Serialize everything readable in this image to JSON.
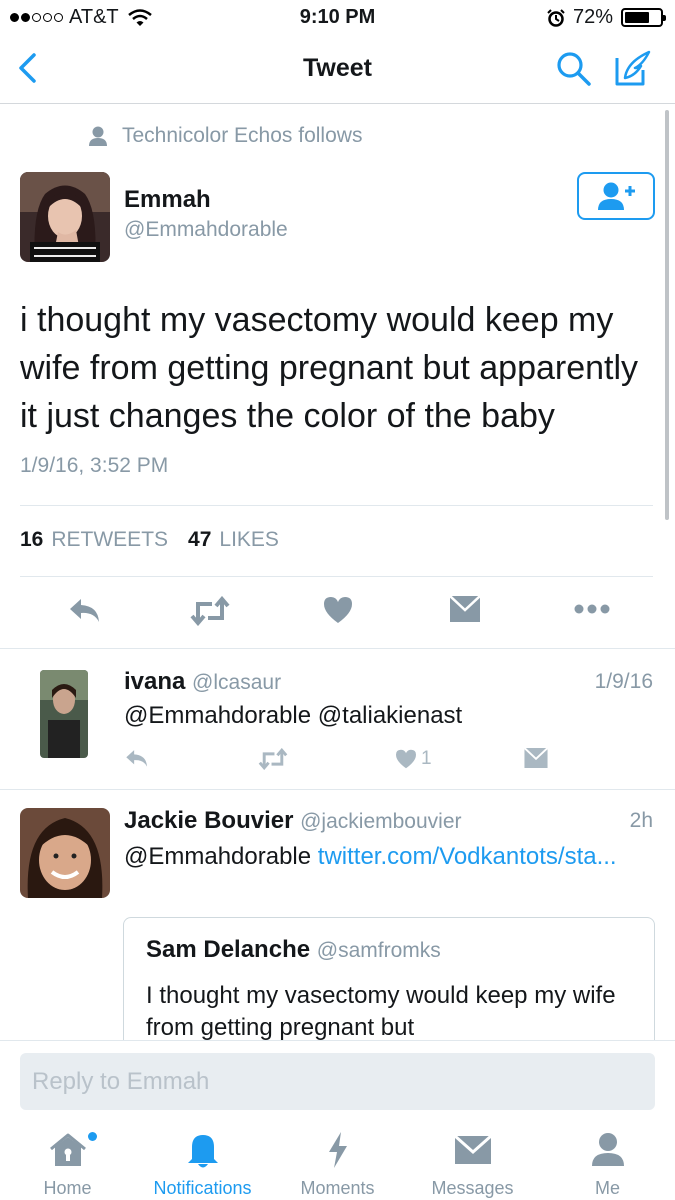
{
  "status_bar": {
    "carrier": "AT&T",
    "time": "9:10 PM",
    "battery": "72%",
    "battery_level": 0.72
  },
  "nav": {
    "title": "Tweet"
  },
  "tweet": {
    "social_context": "Technicolor Echos follows",
    "author_name": "Emmah",
    "author_handle": "@Emmahdorable",
    "text": "i thought my vasectomy would keep my wife from getting pregnant but apparently it just changes the color of the baby",
    "timestamp": "1/9/16, 3:52 PM",
    "retweets_count": "16",
    "retweets_label": "RETWEETS",
    "likes_count": "47",
    "likes_label": "LIKES"
  },
  "replies": [
    {
      "name": "ivana",
      "handle": "@lcasaur",
      "date": "1/9/16",
      "text": "@Emmahdorable @taliakienast",
      "like_count": "1"
    },
    {
      "name": "Jackie Bouvier",
      "handle": "@jackiembouvier",
      "date": "2h",
      "text_prefix": "@Emmahdorable ",
      "link_text": "twitter.com/Vodkantots/sta...",
      "quote": {
        "name": "Sam Delanche",
        "handle": "@samfromks",
        "text": "I thought my vasectomy would keep my wife from getting pregnant but"
      }
    }
  ],
  "reply_bar": {
    "placeholder": "Reply to Emmah"
  },
  "tabs": [
    {
      "label": "Home",
      "icon": "home-icon"
    },
    {
      "label": "Notifications",
      "icon": "bell-icon"
    },
    {
      "label": "Moments",
      "icon": "lightning-icon"
    },
    {
      "label": "Messages",
      "icon": "envelope-icon"
    },
    {
      "label": "Me",
      "icon": "person-icon"
    }
  ],
  "colors": {
    "accent": "#1d9bf0",
    "muted": "#8899a6",
    "text": "#14171a"
  }
}
